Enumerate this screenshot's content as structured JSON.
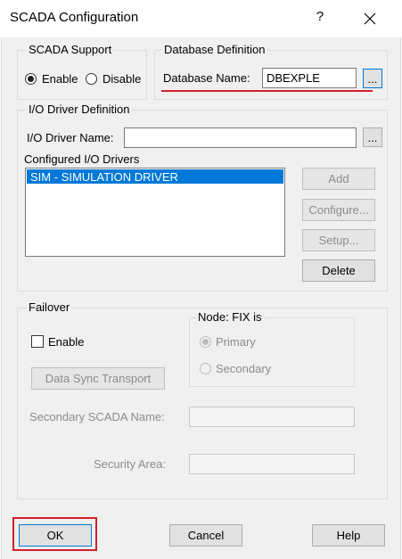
{
  "window": {
    "title": "SCADA Configuration",
    "help_glyph": "?"
  },
  "scada_support": {
    "legend": "SCADA Support",
    "enable_label": "Enable",
    "disable_label": "Disable",
    "selected": "enable"
  },
  "database_definition": {
    "legend": "Database Definition",
    "name_label": "Database Name:",
    "name_value": "DBEXPLE",
    "browse_label": "..."
  },
  "io_driver_definition": {
    "legend": "I/O Driver Definition",
    "name_label": "I/O Driver Name:",
    "name_value": "",
    "browse_label": "...",
    "configured_label": "Configured I/O Drivers",
    "drivers": [
      "SIM - SIMULATION DRIVER"
    ],
    "buttons": {
      "add": "Add",
      "configure": "Configure...",
      "setup": "Setup...",
      "delete": "Delete"
    }
  },
  "failover": {
    "legend": "Failover",
    "enable_label": "Enable",
    "enable_checked": false,
    "node_legend": "Node: FIX is",
    "primary_label": "Primary",
    "secondary_label": "Secondary",
    "node_selected": "primary",
    "sync_button": "Data Sync Transport",
    "secondary_name_label": "Secondary SCADA Name:",
    "secondary_name_value": "",
    "security_area_label": "Security Area:",
    "security_area_value": ""
  },
  "footer": {
    "ok": "OK",
    "cancel": "Cancel",
    "help": "Help"
  },
  "colors": {
    "selection": "#0078d7",
    "annotation_red": "#d0202a",
    "focus_blue": "#0078d7"
  }
}
